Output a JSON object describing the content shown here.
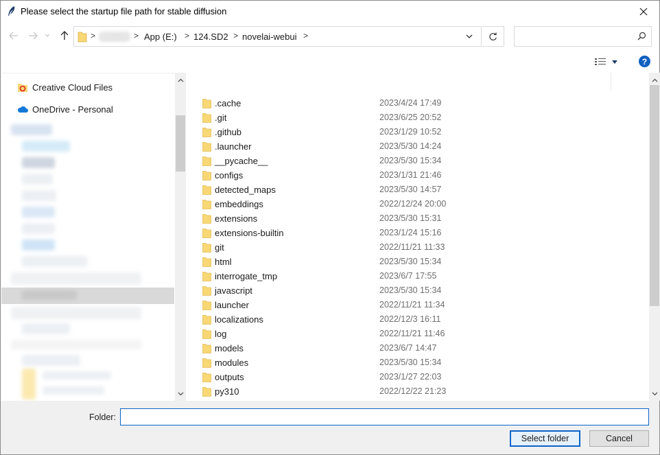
{
  "window": {
    "title": "Please select the startup file path for stable diffusion"
  },
  "address": {
    "crumbs": [
      "App (E:)",
      "124.SD2",
      "novelai-webui"
    ],
    "separator": ">"
  },
  "search": {
    "placeholder": ""
  },
  "nav_pane": {
    "items": [
      {
        "label": "Creative Cloud Files",
        "icon": "creative-cloud-icon"
      },
      {
        "label": "OneDrive - Personal",
        "icon": "onedrive-icon"
      }
    ]
  },
  "files": [
    {
      "name": ".cache",
      "date": "2023/4/24 17:49"
    },
    {
      "name": ".git",
      "date": "2023/6/25 20:52"
    },
    {
      "name": ".github",
      "date": "2023/1/29 10:52"
    },
    {
      "name": ".launcher",
      "date": "2023/5/30 14:24"
    },
    {
      "name": "__pycache__",
      "date": "2023/5/30 15:34"
    },
    {
      "name": "configs",
      "date": "2023/1/31 21:46"
    },
    {
      "name": "detected_maps",
      "date": "2023/5/30 14:57"
    },
    {
      "name": "embeddings",
      "date": "2022/12/24 20:00"
    },
    {
      "name": "extensions",
      "date": "2023/5/30 15:31"
    },
    {
      "name": "extensions-builtin",
      "date": "2023/1/24 15:16"
    },
    {
      "name": "git",
      "date": "2022/11/21 11:33"
    },
    {
      "name": "html",
      "date": "2023/5/30 15:34"
    },
    {
      "name": "interrogate_tmp",
      "date": "2023/6/7 17:55"
    },
    {
      "name": "javascript",
      "date": "2023/5/30 15:34"
    },
    {
      "name": "launcher",
      "date": "2022/11/21 11:34"
    },
    {
      "name": "localizations",
      "date": "2022/12/3 16:11"
    },
    {
      "name": "log",
      "date": "2022/11/21 11:46"
    },
    {
      "name": "models",
      "date": "2023/6/7 14:47"
    },
    {
      "name": "modules",
      "date": "2023/5/30 15:34"
    },
    {
      "name": "outputs",
      "date": "2023/1/27 22:03"
    },
    {
      "name": "py310",
      "date": "2022/12/22 21:23"
    }
  ],
  "bottom": {
    "folder_label": "Folder:",
    "folder_value": "",
    "select_label": "Select folder",
    "cancel_label": "Cancel"
  },
  "colors": {
    "accent": "#0a64c8",
    "folder": "#f8d775",
    "help": "#1060c0",
    "selected": "#d9d9d9"
  }
}
